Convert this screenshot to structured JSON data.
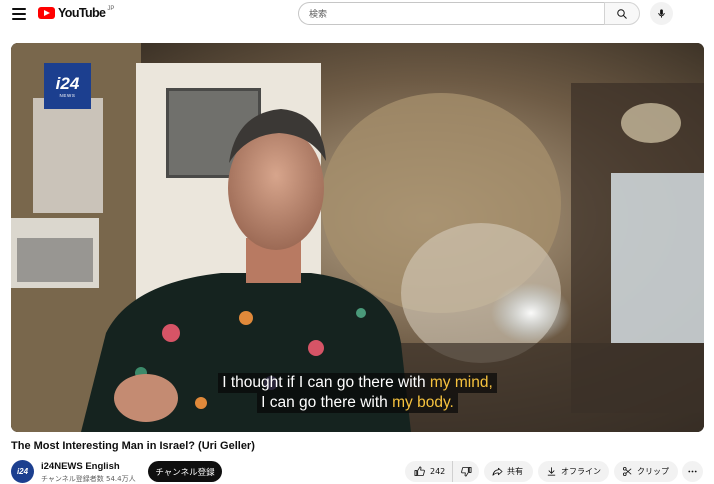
{
  "header": {
    "logo_text": "YouTube",
    "region_code": "JP",
    "search_placeholder": "検索"
  },
  "video": {
    "channel_bug": "i24",
    "channel_bug_sub": "NEWS",
    "subtitle_line1_pre": "I thought if I can go there with ",
    "subtitle_line1_hl": "my mind,",
    "subtitle_line2_pre": "I can go there with ",
    "subtitle_line2_hl": "my body.",
    "subtitle_highlight_color": "#f6c23e"
  },
  "details": {
    "title": "The Most Interesting Man in Israel? (Uri Geller)",
    "channel_avatar_text": "i24",
    "channel_name": "i24NEWS English",
    "subscriber_count": "チャンネル登録者数 54.4万人",
    "subscribe_label": "チャンネル登録"
  },
  "actions": {
    "like_count": "242",
    "share_label": "共有",
    "offline_label": "オフライン",
    "clip_label": "クリップ"
  },
  "colors": {
    "brand_red": "#ff0000",
    "i24_blue": "#1c3f8f"
  }
}
